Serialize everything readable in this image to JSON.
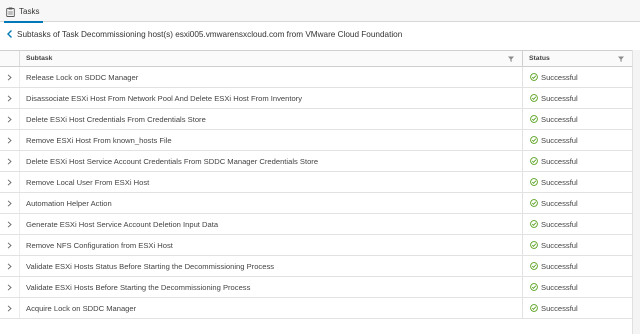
{
  "tab": {
    "label": "Tasks"
  },
  "subtitle": "Subtasks of Task Decommissioning host(s) esxi005.vmwarensxcloud.com from VMware Cloud Foundation",
  "columns": {
    "subtask": "Subtask",
    "status": "Status"
  },
  "colors": {
    "accent": "#0079b8",
    "success": "#5aa220"
  },
  "rows": [
    {
      "subtask": "Release Lock on SDDC Manager",
      "status": "Successful"
    },
    {
      "subtask": "Disassociate ESXi Host From Network Pool And Delete ESXi Host From Inventory",
      "status": "Successful"
    },
    {
      "subtask": "Delete ESXi Host Credentials From Credentials Store",
      "status": "Successful"
    },
    {
      "subtask": "Remove ESXi Host From known_hosts File",
      "status": "Successful"
    },
    {
      "subtask": "Delete ESXi Host Service Account Credentials From SDDC Manager Credentials Store",
      "status": "Successful"
    },
    {
      "subtask": "Remove Local User From ESXi Host",
      "status": "Successful"
    },
    {
      "subtask": "Automation Helper Action",
      "status": "Successful"
    },
    {
      "subtask": "Generate ESXi Host Service Account Deletion Input Data",
      "status": "Successful"
    },
    {
      "subtask": "Remove NFS Configuration from ESXi Host",
      "status": "Successful"
    },
    {
      "subtask": "Validate ESXi Hosts Status Before Starting the Decommissioning Process",
      "status": "Successful"
    },
    {
      "subtask": "Validate ESXi Hosts Before Starting the Decommissioning Process",
      "status": "Successful"
    },
    {
      "subtask": "Acquire Lock on SDDC Manager",
      "status": "Successful"
    }
  ]
}
